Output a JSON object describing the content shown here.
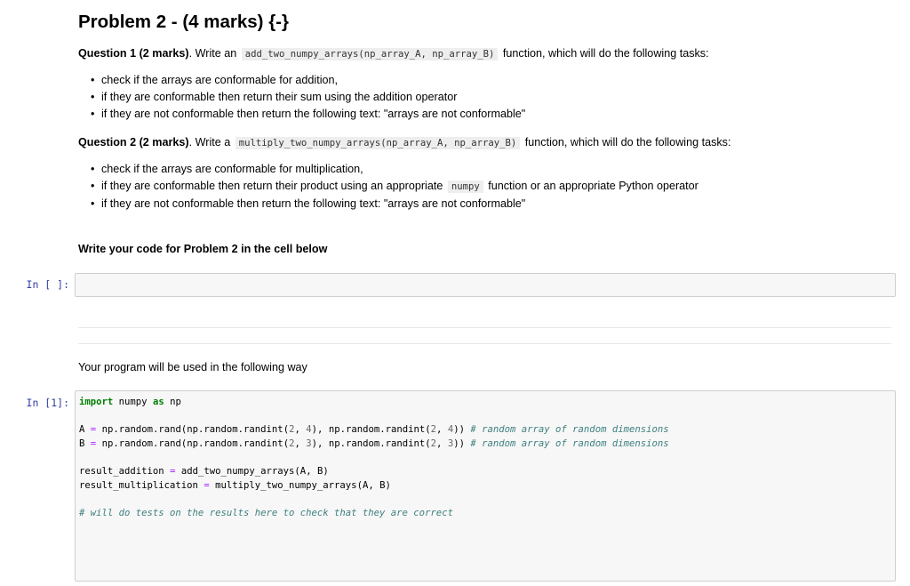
{
  "title": "Problem 2 - (4 marks) {-}",
  "q1": {
    "label": "Question 1 (2 marks)",
    "intro": ". Write an",
    "code": "add_two_numpy_arrays(np_array_A, np_array_B)",
    "suffix": "function, which will do the following tasks:",
    "items": [
      "check if the arrays are conformable for addition,",
      "if they are conformable then return their sum using the addition operator",
      "if they are not conformable then return the following text: \"arrays are not conformable\""
    ]
  },
  "q2": {
    "label": "Question 2 (2 marks)",
    "intro": ". Write a",
    "code": "multiply_two_numpy_arrays(np_array_A, np_array_B)",
    "suffix": "function, which will do the following tasks:",
    "items": [
      "check if the arrays are conformable for multiplication,",
      {
        "before": "if they are conformable then return their product using an appropriate",
        "code": "numpy",
        "after": "function or an appropriate Python operator"
      },
      "if they are not conformable then return the following text: \"arrays are not conformable\""
    ]
  },
  "write_code_heading": "Write your code for Problem 2 in the cell below",
  "empty_cell": {
    "prompt": "In [ ]:",
    "content": ""
  },
  "usage_text": "Your program will be used in the following way",
  "code_cell": {
    "prompt": "In [1]:",
    "lines": [
      "import numpy as np",
      "",
      "A = np.random.rand(np.random.randint(2, 4), np.random.randint(2, 4)) # random array of random dimensions",
      "B = np.random.rand(np.random.randint(2, 3), np.random.randint(2, 3)) # random array of random dimensions",
      "",
      "result_addition = add_two_numpy_arrays(A, B)",
      "result_multiplication = multiply_two_numpy_arrays(A, B)",
      "",
      "# will do tests on the results here to check that they are correct"
    ]
  },
  "colors": {
    "prompt": "#303f9f",
    "keyword": "#008000",
    "comment": "#408080",
    "operator": "#aa22ff",
    "number": "#666666",
    "cell_bg": "#f7f7f7",
    "cell_border": "#cfcfcf"
  }
}
